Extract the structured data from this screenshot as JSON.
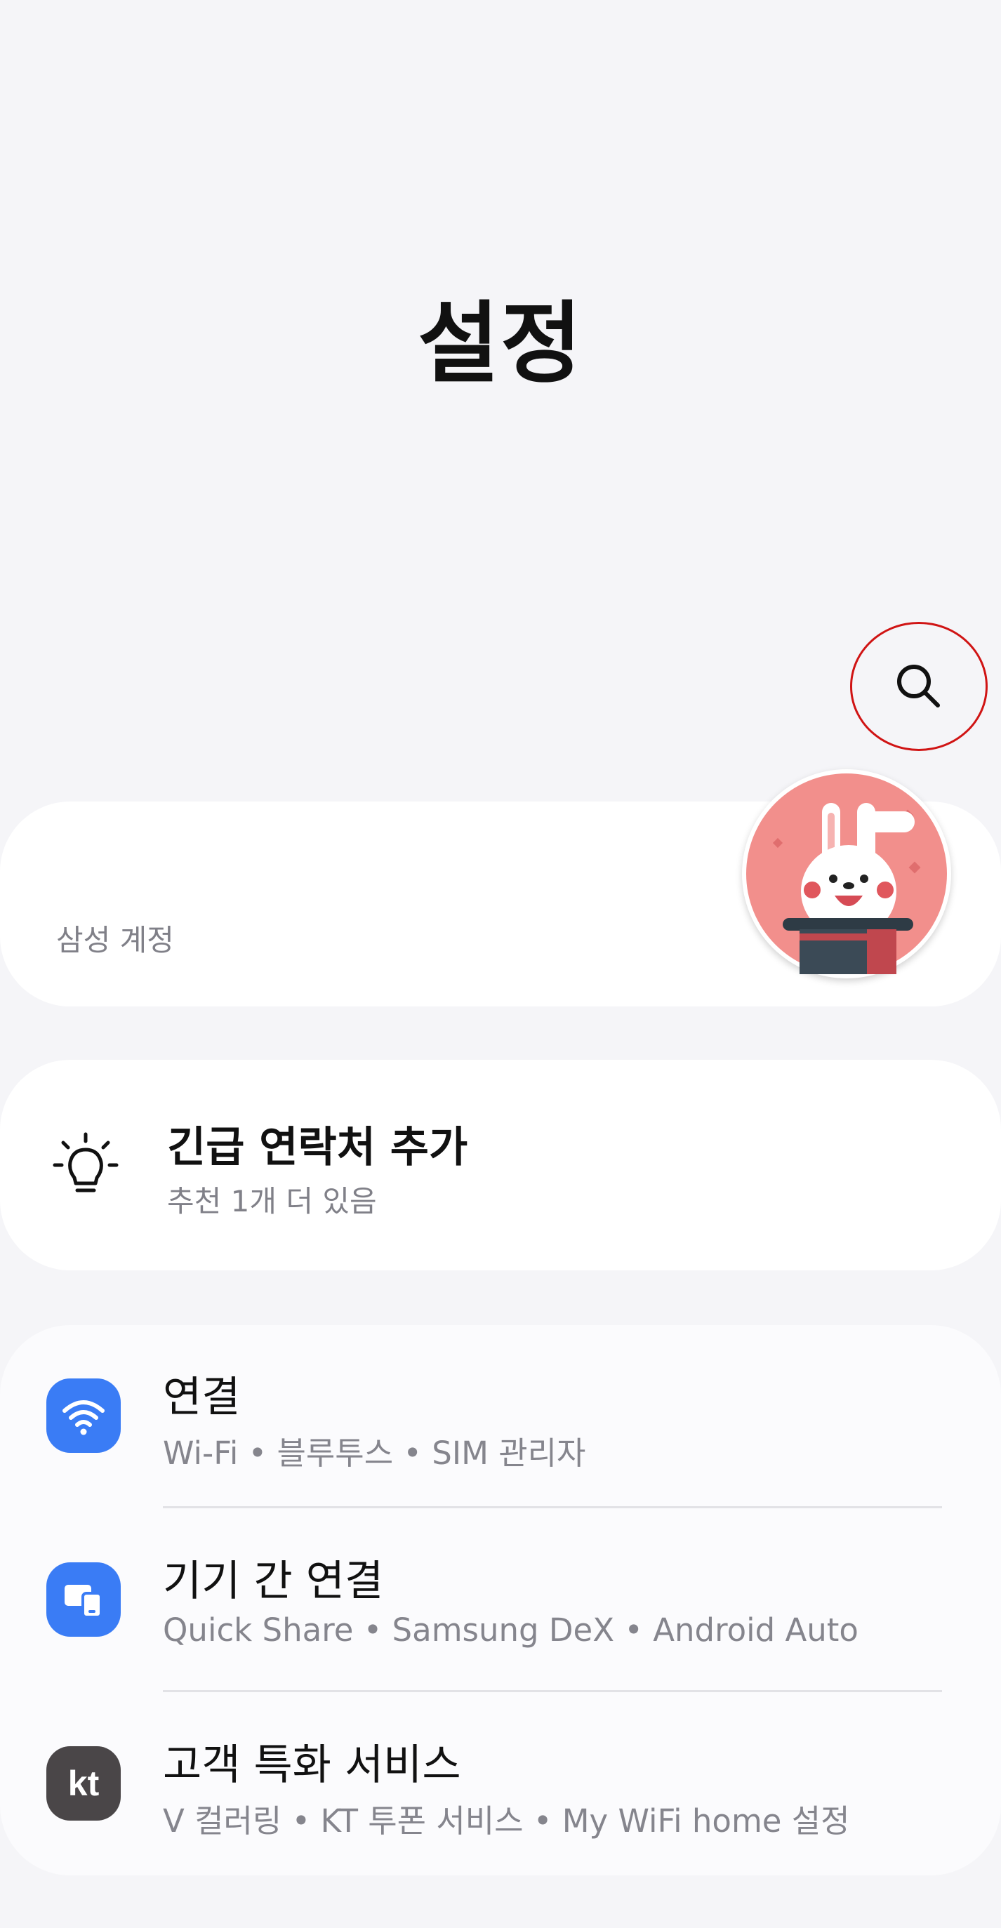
{
  "header": {
    "title": "설정"
  },
  "search": {
    "icon": "search-icon"
  },
  "account": {
    "name": "",
    "subtitle": "삼성 계정",
    "avatar_icon": "bunny-in-hat-avatar"
  },
  "suggestion": {
    "icon": "lightbulb-icon",
    "title": "긴급 연락처 추가",
    "subtitle": "추천 1개 더 있음"
  },
  "menu": {
    "items": [
      {
        "icon": "wifi-icon",
        "icon_color": "#3a7cf5",
        "title": "연결",
        "subtitle": "Wi-Fi  •  블루투스  •  SIM 관리자"
      },
      {
        "icon": "devices-icon",
        "icon_color": "#3a7cf5",
        "title": "기기 간 연결",
        "subtitle": "Quick Share  •  Samsung DeX  •  Android Auto"
      },
      {
        "icon": "kt-logo-icon",
        "icon_color": "#4a4648",
        "title": "고객 특화 서비스",
        "subtitle": "V 컬러링  •  KT 투폰 서비스  •  My WiFi home 설정"
      }
    ]
  },
  "colors": {
    "background": "#f5f5f8",
    "card": "#ffffff",
    "highlight": "#d01414"
  }
}
